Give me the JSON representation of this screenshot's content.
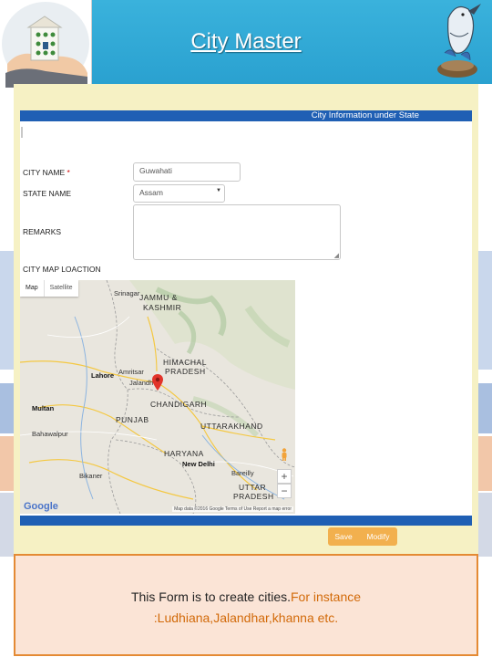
{
  "slide": {
    "title": "City Master"
  },
  "form": {
    "section_header": "City Information under State",
    "city_name_label": "CITY NAME",
    "required_mark": "*",
    "city_name_value": "Guwahati",
    "state_name_label": "STATE NAME",
    "state_name_value": "Assam",
    "remarks_label": "REMARKS",
    "remarks_value": "",
    "map_location_label": "CITY MAP LOACTION"
  },
  "map": {
    "tabs": [
      "Map",
      "Satellite"
    ],
    "labels": {
      "srinagar": "Srinagar",
      "jammu_kashmir_1": "JAMMU &",
      "jammu_kashmir_2": "KASHMIR",
      "himachal_1": "HIMACHAL",
      "himachal_2": "PRADESH",
      "lahore": "Lahore",
      "amritsar": "Amritsar",
      "jalandhar": "Jalandh",
      "chandigarh": "CHANDIGARH",
      "punjab": "PUNJAB",
      "multan": "Multan",
      "uttarakhand": "UTTARAKHAND",
      "bahawalpur": "Bahawalpur",
      "haryana": "HARYANA",
      "new_delhi": "New Delhi",
      "bareilly": "Bareilly",
      "bikaner": "Bikaner",
      "uttar_1": "UTTAR",
      "uttar_2": "PRADESH"
    },
    "zoom_in": "+",
    "zoom_out": "−",
    "google": "Google",
    "attribution": "Map data ©2016 Google  Terms of Use  Report a map error"
  },
  "actions": {
    "save_label": "Save",
    "modify_label": "Modify"
  },
  "note": {
    "line1_black": "This  Form is to create cities.",
    "line1_orange": "For instance",
    "line2_orange": ":Ludhiana,Jalandhar,khanna etc."
  },
  "colors": {
    "header_blue": "#1f5fb4",
    "button_orange": "#f2b04e",
    "note_border": "#e48a34",
    "note_text_orange": "#d26a0a"
  }
}
